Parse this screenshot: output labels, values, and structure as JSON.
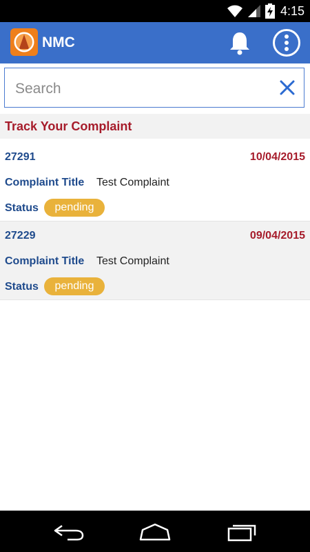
{
  "status_bar": {
    "time": "4:15",
    "icons": [
      "wifi-icon",
      "signal-icon",
      "battery-charging-icon"
    ]
  },
  "app_bar": {
    "title": "NMC",
    "logo": "nmc-logo",
    "actions": [
      "bell-icon",
      "more-vert-icon"
    ],
    "color": "#3a6fc9"
  },
  "search": {
    "placeholder": "Search",
    "clear_icon": "close-icon"
  },
  "section": {
    "title": "Track Your Complaint"
  },
  "complaints": [
    {
      "id": "27291",
      "date": "10/04/2015",
      "title_label": "Complaint Title",
      "title_value": "Test Complaint",
      "status_label": "Status",
      "status_value": "pending"
    },
    {
      "id": "27229",
      "date": "09/04/2015",
      "title_label": "Complaint Title",
      "title_value": "Test Complaint",
      "status_label": "Status",
      "status_value": "pending"
    }
  ],
  "colors": {
    "accent_blue": "#1e4a8c",
    "accent_red": "#a61b2a",
    "badge_yellow": "#e9b23b"
  },
  "nav_bar": {
    "buttons": [
      "back-icon",
      "home-icon",
      "recent-apps-icon"
    ]
  }
}
